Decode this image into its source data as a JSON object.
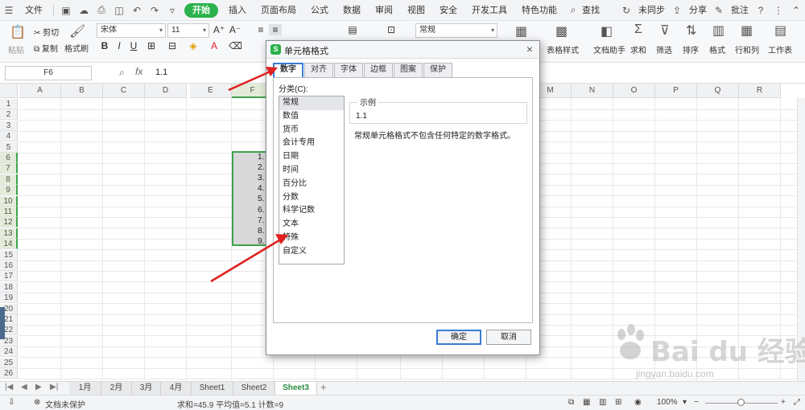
{
  "menubar": {
    "file": "文件",
    "tabs": [
      "开始",
      "插入",
      "页面布局",
      "公式",
      "数据",
      "审阅",
      "视图",
      "安全",
      "开发工具",
      "特色功能"
    ],
    "search": "查找",
    "sync": "未同步",
    "share": "分享",
    "comment": "批注"
  },
  "ribbon": {
    "paste": "粘贴",
    "cut": "剪切",
    "copy": "复制",
    "format_painter": "格式刷",
    "font_name": "宋体",
    "font_size": "11",
    "number_format": "常规",
    "table_style": "表格样式",
    "doc_helper": "文档助手",
    "sum": "求和",
    "filter": "筛选",
    "sort": "排序",
    "format": "格式",
    "rows_cols": "行和列",
    "worksheet": "工作表"
  },
  "formula_bar": {
    "cell_ref": "F6",
    "fx": "fx",
    "value": "1.1"
  },
  "grid": {
    "columns": [
      "A",
      "B",
      "C",
      "D",
      "E",
      "F",
      "G",
      "H",
      "I",
      "J",
      "K",
      "L",
      "M",
      "N",
      "O",
      "P",
      "Q",
      "R"
    ],
    "rows": [
      "1",
      "2",
      "3",
      "4",
      "5",
      "6",
      "7",
      "8",
      "9",
      "10",
      "11",
      "12",
      "13",
      "14",
      "15",
      "16",
      "17",
      "18",
      "19",
      "20",
      "21",
      "22",
      "23",
      "24",
      "25",
      "26"
    ],
    "values": [
      "1.",
      "2.",
      "3.",
      "4.",
      "5.",
      "6.",
      "7.",
      "8.",
      "9."
    ]
  },
  "sheets": {
    "tabs": [
      "1月",
      "2月",
      "3月",
      "4月",
      "Sheet1",
      "Sheet2",
      "Sheet3"
    ],
    "active": "Sheet3",
    "add": "+"
  },
  "status": {
    "protect": "文档未保护",
    "stats": "求和=45.9   平均值=5.1   计数=9",
    "zoom": "100%"
  },
  "dialog": {
    "title": "单元格格式",
    "tabs": [
      "数字",
      "对齐",
      "字体",
      "边框",
      "图案",
      "保护"
    ],
    "category_label": "分类(C):",
    "categories": [
      "常规",
      "数值",
      "货币",
      "会计专用",
      "日期",
      "时间",
      "百分比",
      "分数",
      "科学记数",
      "文本",
      "特殊",
      "自定义"
    ],
    "selected_category": "常规",
    "sample_label": "示例",
    "sample_value": "1.1",
    "description": "常规单元格格式不包含任何特定的数字格式。",
    "ok": "确定",
    "cancel": "取消"
  },
  "watermark": {
    "text": "Bai du 经验",
    "sub": "jingyan.baidu.com"
  },
  "colors": {
    "accent_green": "#2bb24c",
    "selection_border": "#3fa34d",
    "arrow_red": "#e02020",
    "dialog_focus": "#3a7bd5"
  }
}
